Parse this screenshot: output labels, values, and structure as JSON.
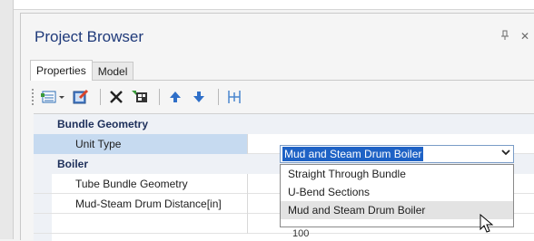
{
  "window": {
    "title": "Project Browser"
  },
  "tabs": [
    {
      "label": "Properties",
      "active": true
    },
    {
      "label": "Model",
      "active": false
    }
  ],
  "toolbar": {
    "icons": [
      "categorized-view-icon",
      "edit-icon",
      "delete-icon",
      "expand-icon",
      "move-up-icon",
      "move-down-icon",
      "split-icon"
    ]
  },
  "grid": {
    "categories": [
      {
        "label": "Bundle Geometry"
      },
      {
        "label": "Boiler"
      }
    ],
    "properties": [
      {
        "label": "Unit Type",
        "value": "Mud and Steam Drum Boiler"
      },
      {
        "label": "Tube Bundle Geometry",
        "value": ""
      },
      {
        "label": "Mud-Steam Drum Distance[in]",
        "value": "100"
      }
    ]
  },
  "dropdown": {
    "options": [
      "Straight Through Bundle",
      "U-Bend Sections",
      "Mud and Steam Drum Boiler"
    ],
    "hovered": "Mud and Steam Drum Boiler"
  },
  "colors": {
    "accent": "#1e62c5",
    "selected_row": "#c6daf0",
    "title": "#1f3a7a"
  }
}
